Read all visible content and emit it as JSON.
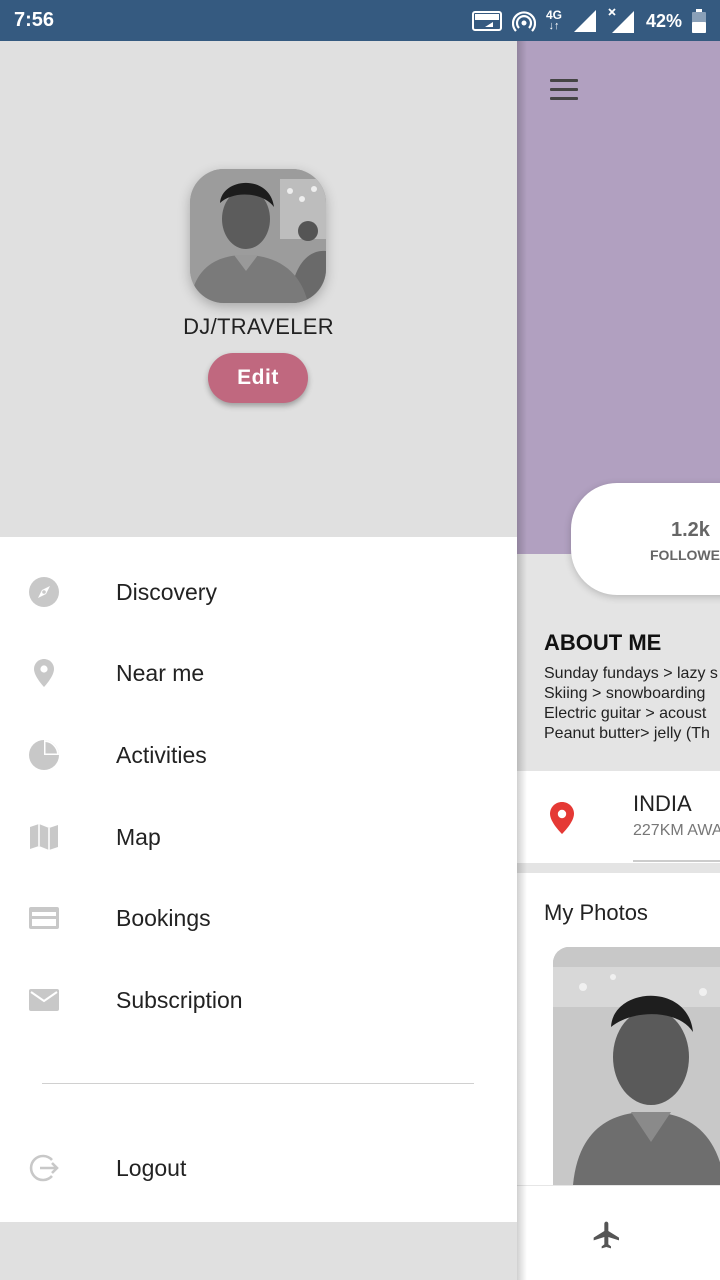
{
  "status_bar": {
    "time": "7:56",
    "network_label": "4G",
    "battery": "42%",
    "icons": [
      "volte-icon",
      "hotspot-icon",
      "signal-icon",
      "signal-x-icon",
      "battery-icon"
    ]
  },
  "drawer": {
    "profile_name": "DJ/TRAVELER",
    "edit_label": "Edit",
    "items": [
      {
        "label": "Discovery",
        "icon": "compass-icon"
      },
      {
        "label": "Near me",
        "icon": "location-pin-icon"
      },
      {
        "label": "Activities",
        "icon": "pie-chart-icon"
      },
      {
        "label": "Map",
        "icon": "map-icon"
      },
      {
        "label": "Bookings",
        "icon": "credit-card-icon"
      },
      {
        "label": "Subscription",
        "icon": "mail-icon"
      }
    ],
    "logout_label": "Logout",
    "logout_icon": "logout-icon"
  },
  "profile": {
    "stat_value": "1.2k",
    "stat_label": "FOLLOWER",
    "about_title": "ABOUT ME",
    "about_lines": [
      "Sunday fundays > lazy s",
      "Skiing > snowboarding",
      "Electric guitar > acoust",
      "Peanut butter> jelly (Th"
    ],
    "location_name": "INDIA",
    "location_distance": "227KM AWA",
    "photos_title": "My Photos",
    "bottom_icon": "airplane-icon"
  },
  "colors": {
    "status_bar": "#355a80",
    "edit_button": "#c0687f",
    "profile_header": "#b1a0c0",
    "location_pin": "#e53935",
    "drawer_icon": "#c8c8c8"
  }
}
